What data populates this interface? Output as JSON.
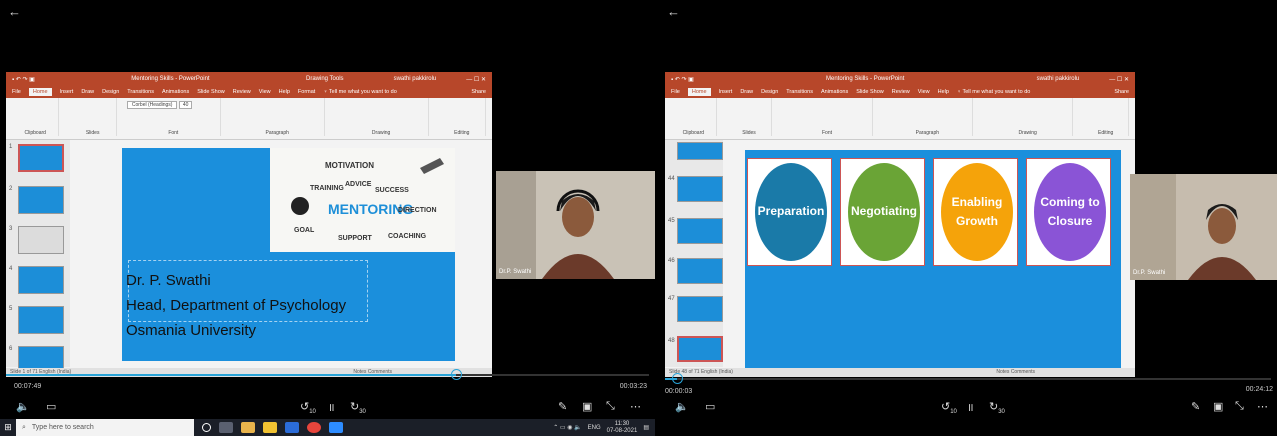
{
  "left": {
    "back_icon": "←",
    "ppt": {
      "title": "Mentoring Skills - PowerPoint",
      "context_tab": "Drawing Tools",
      "user": "swathi pakkirolu",
      "tabs": [
        "File",
        "Home",
        "Insert",
        "Draw",
        "Design",
        "Transitions",
        "Animations",
        "Slide Show",
        "Review",
        "View",
        "Help",
        "Format"
      ],
      "tell_me": "Tell me what you want to do",
      "share": "Share",
      "ribbon_groups": [
        "Clipboard",
        "Slides",
        "Font",
        "Paragraph",
        "Drawing",
        "Editing"
      ],
      "font_name": "Corbel (Headings)",
      "font_size": "40",
      "slide_numbers": [
        "1",
        "2",
        "3",
        "4",
        "5",
        "6"
      ],
      "status": "Slide 1 of 71   English (India)",
      "status_right": "Notes   Comments"
    },
    "slide": {
      "lines": [
        "Dr. P. Swathi",
        "Head, Department of Psychology",
        "Osmania University"
      ],
      "image_words": [
        "MOTIVATION",
        "ADVICE",
        "TRAINING",
        "SUCCESS",
        "MENTORING",
        "DIRECTION",
        "GOAL",
        "SUPPORT",
        "COACHING"
      ]
    },
    "video_name": "Dr.P. Swathi",
    "time_current": "00:07:49",
    "time_total": "00:03:23",
    "progress": 0.7,
    "controls": {
      "volume": "🔈",
      "captions": "▭",
      "rewind": "↺",
      "pause": "॥",
      "forward": "↻",
      "edit": "✎",
      "screen": "▣",
      "shrink": "⤡",
      "more": "⋯"
    },
    "rewind_label": "10",
    "forward_label": "30"
  },
  "right": {
    "back_icon": "←",
    "ppt": {
      "title": "Mentoring Skills - PowerPoint",
      "user": "swathi pakkirolu",
      "tabs": [
        "File",
        "Home",
        "Insert",
        "Draw",
        "Design",
        "Transitions",
        "Animations",
        "Slide Show",
        "Review",
        "View",
        "Help"
      ],
      "tell_me": "Tell me what you want to do",
      "share": "Share",
      "slide_numbers": [
        "44",
        "45",
        "46",
        "47",
        "48"
      ],
      "status": "Slide 48 of 71   English (India)"
    },
    "slide": {
      "circles": [
        {
          "label": "Preparation",
          "color": "#1a7aa8"
        },
        {
          "label": "Negotiating",
          "color": "#6aa436"
        },
        {
          "label": "Enabling\nGrowth",
          "color": "#f5a30a"
        },
        {
          "label": "Coming to\nClosure",
          "color": "#8a54d6"
        }
      ]
    },
    "video_name": "Dr.P. Swathi",
    "time_current": "00:00:03",
    "time_total": "00:24:12",
    "progress": 0.02
  },
  "taskbar": {
    "search_placeholder": "Type here to search",
    "lang": "ENG",
    "time": "11:30",
    "date": "07-08-2021"
  }
}
